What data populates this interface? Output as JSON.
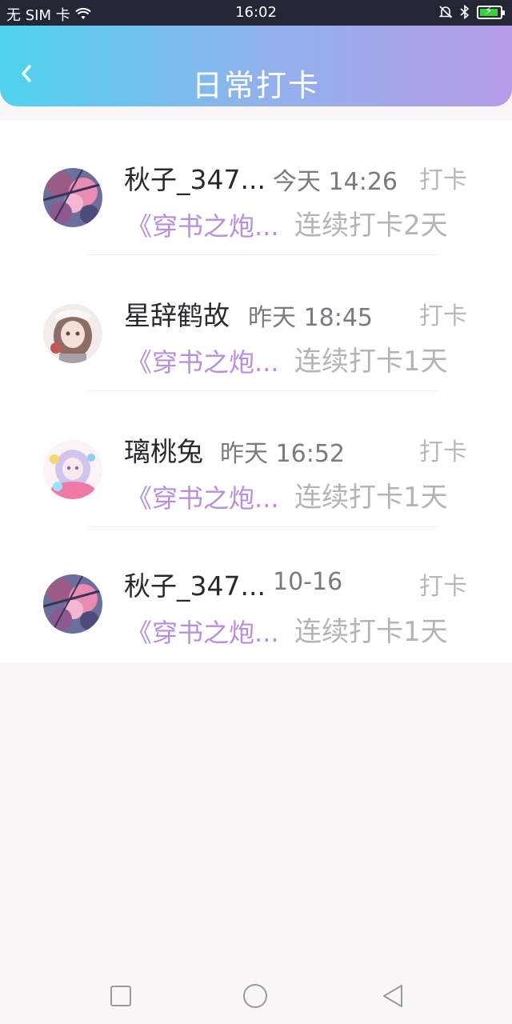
{
  "status_bar": {
    "carrier": "无 SIM 卡",
    "time": "16:02",
    "icons": [
      "wifi-icon",
      "mute-bell-icon",
      "bluetooth-icon",
      "battery-charging-icon"
    ]
  },
  "header": {
    "title": "日常打卡",
    "back_icon": "chevron-left-icon"
  },
  "checkins": [
    {
      "name": "秋子_347...",
      "time": "今天 14:26",
      "tag": "打卡",
      "book": "《穿书之炮...",
      "streak": "连续打卡2天",
      "avatar": "pink-blossom"
    },
    {
      "name": "星辞鹤故",
      "time": "昨天 18:45",
      "tag": "打卡",
      "book": "《穿书之炮...",
      "streak": "连续打卡1天",
      "avatar": "anime-girl-brown"
    },
    {
      "name": "璃桃兔",
      "time": "昨天 16:52",
      "tag": "打卡",
      "book": "《穿书之炮...",
      "streak": "连续打卡1天",
      "avatar": "anime-girl-pastel"
    },
    {
      "name": "秋子_347...",
      "time": "10-16",
      "tag": "打卡",
      "book": "《穿书之炮...",
      "streak": "连续打卡1天",
      "avatar": "pink-blossom"
    }
  ],
  "nav_bar": {
    "icons": [
      "square-recent-icon",
      "circle-home-icon",
      "triangle-back-icon"
    ]
  },
  "colors": {
    "header_gradient_start": "#4fd3ef",
    "header_gradient_end": "#b79be9",
    "book_title": "#b88ede",
    "status_bar_bg": "#232634"
  }
}
